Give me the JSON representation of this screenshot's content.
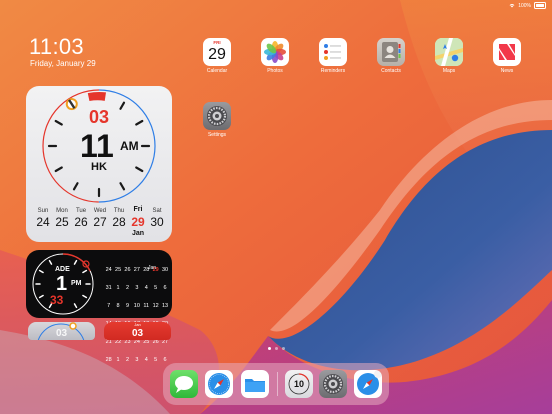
{
  "status": {
    "battery": "100%"
  },
  "lock": {
    "time": "11:03",
    "date": "Friday, January 29"
  },
  "apps": {
    "calendar": {
      "label": "Calendar",
      "day_name": "FRI",
      "day_number": "29"
    },
    "photos": {
      "label": "Photos"
    },
    "reminders": {
      "label": "Reminders"
    },
    "contacts": {
      "label": "Contacts"
    },
    "maps": {
      "label": "Maps"
    },
    "news": {
      "label": "News"
    },
    "settings": {
      "label": "Settings"
    }
  },
  "clock_widget": {
    "top_number": "03",
    "hour": "11",
    "ampm": "AM",
    "city": "HK",
    "week": [
      {
        "day": "Sun",
        "num": "24"
      },
      {
        "day": "Mon",
        "num": "25"
      },
      {
        "day": "Tue",
        "num": "26"
      },
      {
        "day": "Wed",
        "num": "27"
      },
      {
        "day": "Thu",
        "num": "28"
      },
      {
        "day": "Fri",
        "num": "29"
      },
      {
        "day": "Sat",
        "num": "30"
      }
    ],
    "month": "Jan"
  },
  "world_widget": {
    "city": "ADE",
    "hour": "1",
    "ampm": "PM",
    "minutes": "33",
    "month": "Jan",
    "grid": [
      [
        "24",
        "25",
        "26",
        "27",
        "28",
        "29",
        "30"
      ],
      [
        "31",
        "1",
        "2",
        "3",
        "4",
        "5",
        "6"
      ],
      [
        "7",
        "8",
        "9",
        "10",
        "11",
        "12",
        "13"
      ],
      [
        "14",
        "15",
        "16",
        "17",
        "18",
        "19",
        "20"
      ],
      [
        "21",
        "22",
        "23",
        "24",
        "25",
        "26",
        "27"
      ],
      [
        "28",
        "1",
        "2",
        "3",
        "4",
        "5",
        "6"
      ]
    ]
  },
  "small_widgets": {
    "a_number": "03",
    "b_number": "03",
    "b_month": "Jan"
  },
  "dock": {
    "clock_badge": "10"
  },
  "colors": {
    "accent_red": "#e52b22",
    "ring_blue": "#2f7ee6"
  }
}
